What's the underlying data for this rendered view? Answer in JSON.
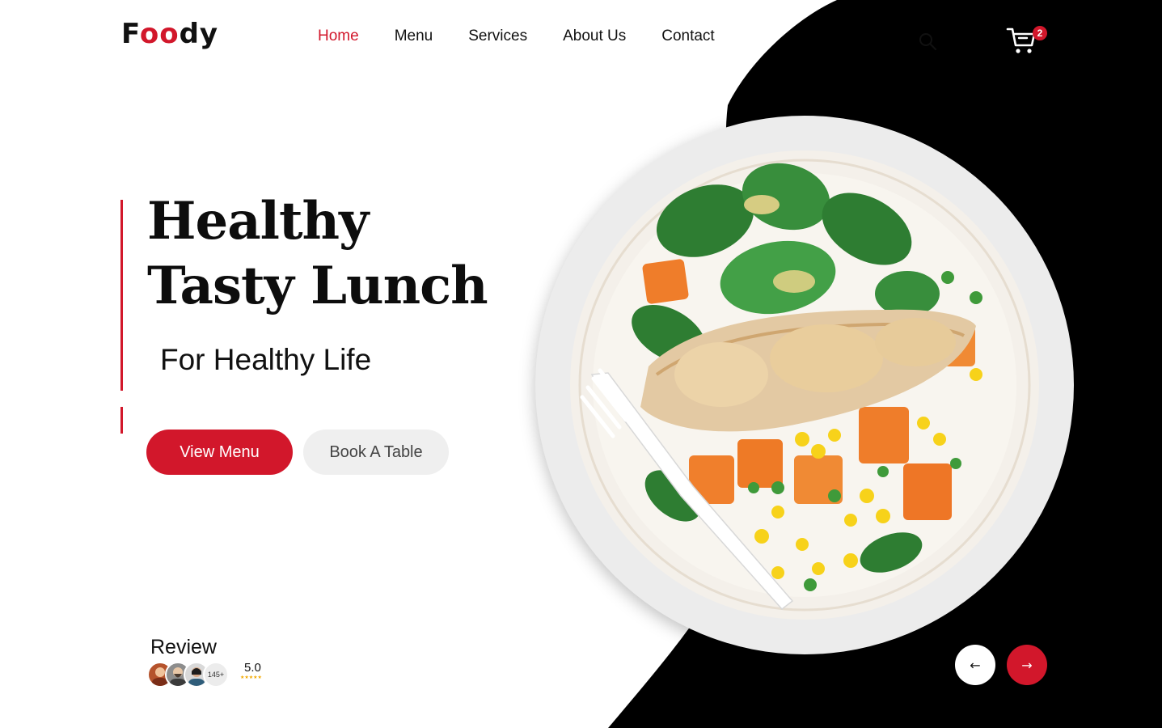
{
  "brand": {
    "logo_prefix": "F",
    "logo_accent": "oo",
    "logo_suffix": "dy",
    "accent_color": "#d2172b"
  },
  "nav": {
    "items": [
      {
        "label": "Home",
        "active": true
      },
      {
        "label": "Menu",
        "active": false
      },
      {
        "label": "Services",
        "active": false
      },
      {
        "label": "About Us",
        "active": false
      },
      {
        "label": "Contact",
        "active": false
      }
    ]
  },
  "header": {
    "search_icon": "search-icon",
    "cart_icon": "cart-icon",
    "cart_count": "2"
  },
  "hero": {
    "title_line_1": "Healthy",
    "title_line_2": "Tasty Lunch",
    "subtitle": "For Healthy Life",
    "primary_button": "View Menu",
    "secondary_button": "Book A Table",
    "image_alt": "plate-of-chicken-salad"
  },
  "review": {
    "title": "Review",
    "reviewer_count": "145+",
    "rating": "5.0",
    "stars": "★★★★★"
  },
  "slider": {
    "prev_label": "←",
    "next_label": "→"
  }
}
